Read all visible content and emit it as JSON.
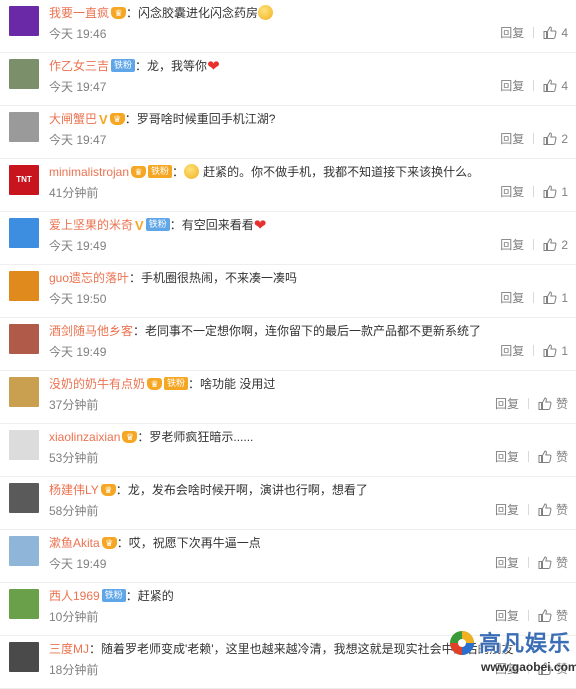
{
  "actions": {
    "reply_label": "回复",
    "like_label_default": "赞"
  },
  "comments": [
    {
      "username": "我要一直疯",
      "badges": [
        "crown"
      ],
      "text": "闪念胶囊进化闪念药房",
      "trail": "emoji",
      "time": "今天 19:46",
      "likes": "4",
      "avatar_color": "#6a2aa8"
    },
    {
      "username": "作乙女三吉",
      "badges": [
        "fan"
      ],
      "fan_label": "铁粉",
      "text": "龙，我等你",
      "trail": "heart",
      "time": "今天 19:47",
      "likes": "4",
      "avatar_color": "#7a8f6a"
    },
    {
      "username": "大闸蟹巴",
      "badges": [
        "v",
        "crown"
      ],
      "text": "罗哥啥时候重回手机江湖?",
      "trail": "",
      "time": "今天 19:47",
      "likes": "2",
      "avatar_color": "#9a9a9a"
    },
    {
      "username": "minimalistrojan",
      "badges": [
        "crown",
        "fan-orange"
      ],
      "fan_label": "铁粉",
      "pre": "emoji",
      "text": "赶紧的。你不做手机，我都不知道接下来该换什么。",
      "trail": "",
      "time": "41分钟前",
      "likes": "1",
      "avatar_color": "#c8141e",
      "avatar_text": "TNT"
    },
    {
      "username": "爱上坚果的米奇",
      "badges": [
        "v",
        "fan"
      ],
      "fan_label": "铁粉",
      "text": "有空回来看看",
      "trail": "heart",
      "time": "今天 19:49",
      "likes": "2",
      "avatar_color": "#3d8ee0"
    },
    {
      "username": "guo遗忘的落叶",
      "badges": [],
      "text": "手机圈很热闹，不来凑一凑吗",
      "trail": "",
      "time": "今天 19:50",
      "likes": "1",
      "avatar_color": "#e08a1e"
    },
    {
      "username": "酒剑随马他乡客",
      "badges": [],
      "text": "老同事不一定想你啊，连你留下的最后一款产品都不更新系统了",
      "trail": "",
      "time": "今天 19:49",
      "likes": "1",
      "avatar_color": "#b05a4a"
    },
    {
      "username": "没奶的奶牛有点奶",
      "badges": [
        "crown",
        "fan-orange"
      ],
      "fan_label": "铁粉",
      "text": "啥功能  没用过",
      "trail": "",
      "time": "37分钟前",
      "likes": "赞",
      "avatar_color": "#c8a050"
    },
    {
      "username": "xiaolinzaixian",
      "badges": [
        "crown"
      ],
      "text": "罗老师疯狂暗示......",
      "trail": "",
      "time": "53分钟前",
      "likes": "赞",
      "avatar_color": "#dcdcdc"
    },
    {
      "username": "杨建伟LY",
      "badges": [
        "crown"
      ],
      "text": "龙，发布会啥时候开啊，演讲也行啊，想看了",
      "trail": "",
      "time": "58分钟前",
      "likes": "赞",
      "avatar_color": "#5a5a5a"
    },
    {
      "username": "漱鱼Akita",
      "badges": [
        "crown"
      ],
      "text": "哎，祝愿下次再牛逼一点",
      "trail": "",
      "time": "今天 19:49",
      "likes": "赞",
      "avatar_color": "#8fb5d8"
    },
    {
      "username": "西人1969",
      "badges": [
        "fan"
      ],
      "fan_label": "铁粉",
      "text": "赶紧的",
      "trail": "",
      "time": "10分钟前",
      "likes": "赞",
      "avatar_color": "#6aa04a"
    },
    {
      "username": "三度MJ",
      "badges": [],
      "text": "随着罗老师变成'老赖'，这里也越来越冷清，我想这就是现实社会中最后的朋友",
      "trail": "",
      "time": "18分钟前",
      "likes": "赞",
      "avatar_color": "#4a4a4a"
    }
  ],
  "watermark": {
    "title": "高凡娱乐",
    "url": "www.gaobei.com"
  }
}
